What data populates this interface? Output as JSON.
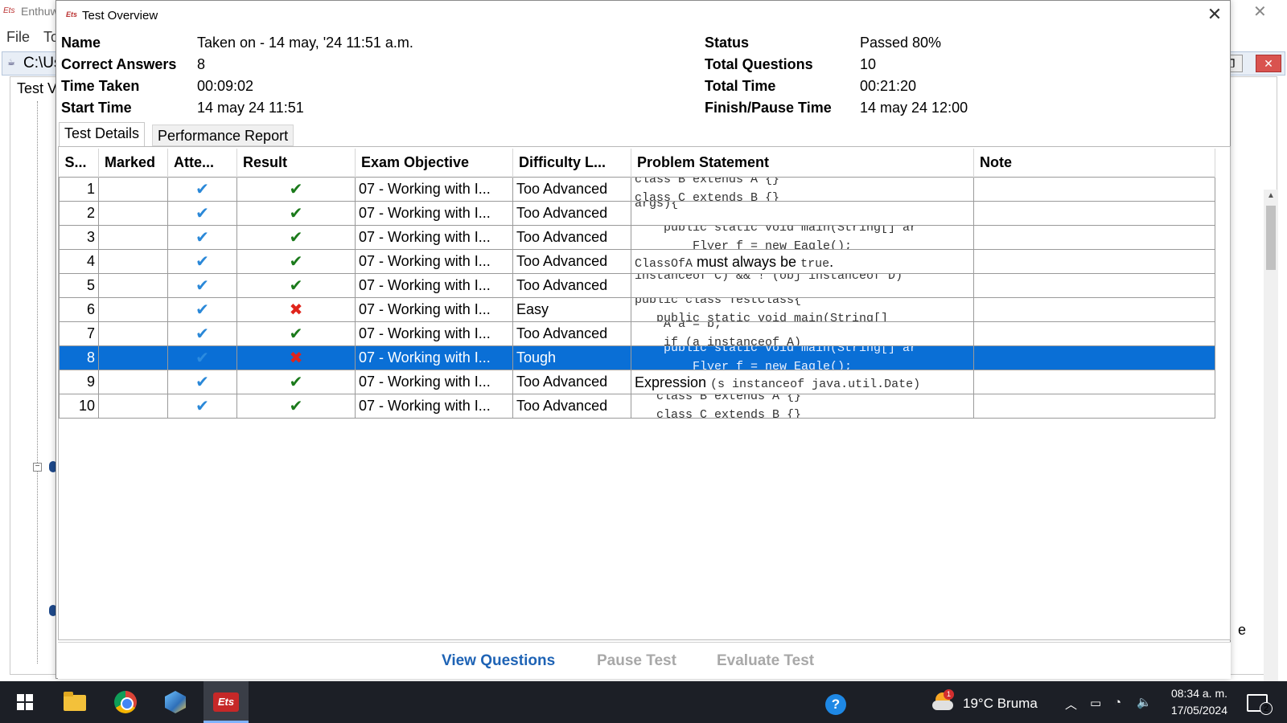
{
  "background_app": {
    "title": "Enthuw",
    "menu": [
      "File",
      "To"
    ],
    "path": "C:\\Us",
    "panel_label": "Test V",
    "stray_text": "e"
  },
  "dialog": {
    "title": "Test Overview",
    "info_left": [
      {
        "label": "Name",
        "value": "Taken on - 14 may, '24 11:51 a.m."
      },
      {
        "label": "Correct Answers",
        "value": "8"
      },
      {
        "label": "Time Taken",
        "value": "00:09:02"
      },
      {
        "label": "Start Time",
        "value": "14 may 24 11:51"
      }
    ],
    "info_right": [
      {
        "label": "Status",
        "value": "Passed 80%"
      },
      {
        "label": "Total Questions",
        "value": "10"
      },
      {
        "label": "Total Time",
        "value": "00:21:20"
      },
      {
        "label": "Finish/Pause Time",
        "value": "14 may 24 12:00"
      }
    ],
    "tabs": [
      {
        "label": "Test Details",
        "active": true
      },
      {
        "label": "Performance Report",
        "active": false
      }
    ],
    "columns": [
      "S...",
      "Marked",
      "Atte...",
      "Result",
      "Exam Objective",
      "Difficulty L...",
      "Problem Statement",
      "Note"
    ],
    "rows": [
      {
        "num": "1",
        "result": "correct",
        "objective": "07 - Working with I...",
        "difficulty": "Too Advanced",
        "problem_l1": "class B extends A {}",
        "problem_l2": "class C extends B {}",
        "note": ""
      },
      {
        "num": "2",
        "result": "correct",
        "objective": "07 - Working with I...",
        "difficulty": "Too Advanced",
        "problem_l1": "args){",
        "problem_l2": "",
        "note": ""
      },
      {
        "num": "3",
        "result": "correct",
        "objective": "07 - Working with I...",
        "difficulty": "Too Advanced",
        "problem_l1": "    public static void main(String[] ar",
        "problem_l2": "        Flyer f = new Eagle();",
        "note": ""
      },
      {
        "num": "4",
        "result": "correct",
        "objective": "07 - Working with I...",
        "difficulty": "Too Advanced",
        "problem_code": "ClassOfA",
        "problem_text": " must always be ",
        "problem_code2": "true",
        "problem_text2": ".",
        "note": ""
      },
      {
        "num": "5",
        "result": "correct",
        "objective": "07 - Working with I...",
        "difficulty": "Too Advanced",
        "problem_l1": "instanceof C) && ! (obj instanceof D)",
        "problem_l2": "",
        "note": ""
      },
      {
        "num": "6",
        "result": "wrong",
        "objective": "07 - Working with I...",
        "difficulty": "Easy",
        "problem_l1": "public class TestClass{",
        "problem_l2": "   public static void main(String[]",
        "note": ""
      },
      {
        "num": "7",
        "result": "correct",
        "objective": "07 - Working with I...",
        "difficulty": "Too Advanced",
        "problem_l1": "    A a = b;",
        "problem_l2": "    if (a instanceof A)",
        "note": ""
      },
      {
        "num": "8",
        "result": "wrong",
        "objective": "07 - Working with I...",
        "difficulty": "Tough",
        "problem_l1": "    public static void main(String[] ar",
        "problem_l2": "        Flyer f = new Eagle();",
        "note": "",
        "selected": true
      },
      {
        "num": "9",
        "result": "correct",
        "objective": "07 - Working with I...",
        "difficulty": "Too Advanced",
        "problem_text": "Expression ",
        "problem_code": "(s instanceof java.util.Date)",
        "note": ""
      },
      {
        "num": "10",
        "result": "correct",
        "objective": "07 - Working with I...",
        "difficulty": "Too Advanced",
        "problem_l1": "   class B extends A {}",
        "problem_l2": "   class C extends B {}",
        "note": ""
      }
    ],
    "buttons": {
      "view_questions": "View Questions",
      "pause_test": "Pause Test",
      "evaluate_test": "Evaluate Test"
    }
  },
  "taskbar": {
    "weather": "19°C  Bruma",
    "weather_badge": "1",
    "time": "08:34 a. m.",
    "date": "17/05/2024",
    "notifications": "2",
    "help_glyph": "?",
    "app_badge": "Ets"
  },
  "icons": {
    "attempted": "✔",
    "correct": "✔",
    "wrong": "✖"
  },
  "colors": {
    "selection": "#0a6fd6",
    "correct": "#1b7a1b",
    "wrong": "#e0241b",
    "attempted": "#2a88d8",
    "link": "#1e63b5"
  }
}
